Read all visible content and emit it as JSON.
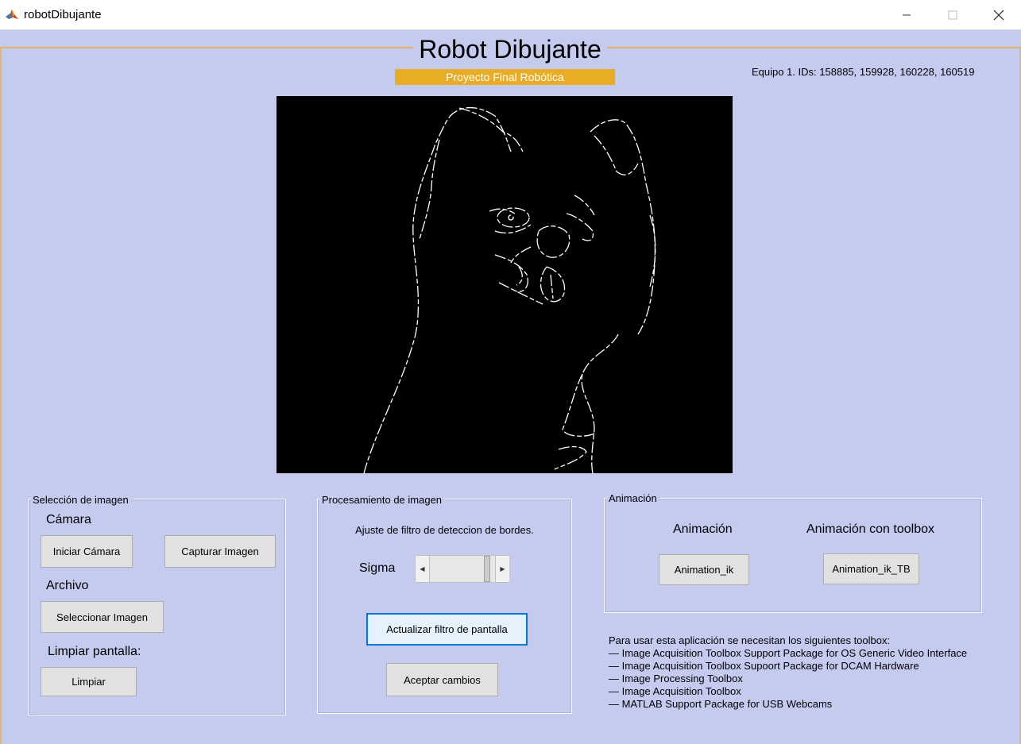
{
  "window": {
    "title": "robotDibujante",
    "icon": "matlab-icon",
    "controls": {
      "minimize": "—",
      "maximize": "☐",
      "close": "✕"
    }
  },
  "header": {
    "title": "Robot Dibujante",
    "subtitle": "Proyecto Final Robótica",
    "team": "Equipo 1. IDs: 158885, 159928, 160228, 160519",
    "accent_color": "#e8ad24"
  },
  "panels": {
    "seleccion": {
      "legend": "Selección de imagen",
      "camara_label": "Cámara",
      "iniciar_camara": "Iniciar Cámara",
      "capturar_imagen": "Capturar Imagen",
      "archivo_label": "Archivo",
      "seleccionar_imagen": "Seleccionar Imagen",
      "limpiar_label": "Limpiar pantalla:",
      "limpiar": "Limpiar"
    },
    "procesamiento": {
      "legend": "Procesamiento de imagen",
      "ajuste_label": "Ajuste de filtro de deteccion de bordes.",
      "sigma_label": "Sigma",
      "sigma_slider_level": 0.92,
      "actualizar": "Actualizar filtro de pantalla",
      "aceptar": "Aceptar cambios"
    },
    "animacion": {
      "legend": "Animación",
      "anim_label": "Animación",
      "anim_toolbox_label": "Animación con toolbox",
      "animation_ik": "Animation_ik",
      "animation_ik_tb": "Animation_ik_TB"
    }
  },
  "toolbox_note": {
    "intro": "Para usar esta aplicación se necesitan los siguientes toolbox:",
    "items": [
      "— Image Acquisition Toolbox Support Package for OS Generic Video Interface",
      "— Image Acquisition Toolbox Supoort Package for DCAM Hardware",
      "— Image Processing Toolbox",
      "— Image Acquisition Toolbox",
      "— MATLAB Support Package for USB Webcams"
    ]
  }
}
